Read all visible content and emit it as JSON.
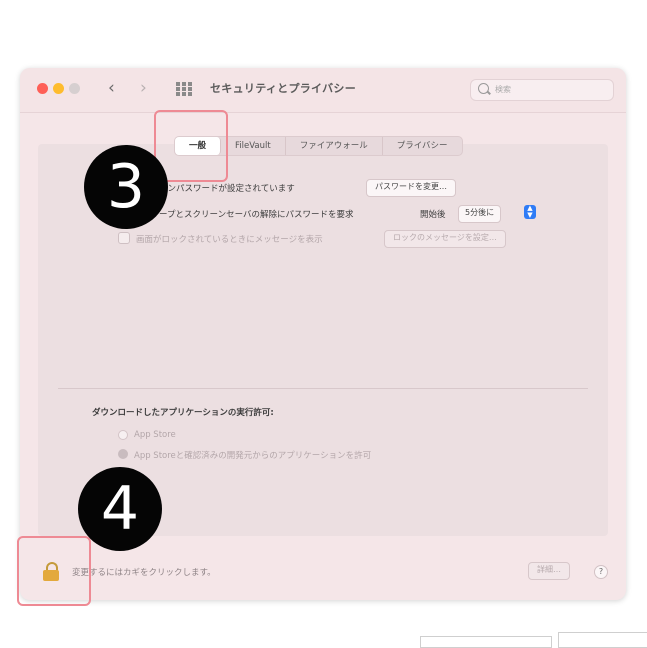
{
  "window": {
    "title": "セキュリティとプライバシー",
    "search_placeholder": "検索",
    "nav_back": "‹",
    "nav_forward": "›"
  },
  "tabs": [
    {
      "label": "一般",
      "active": true
    },
    {
      "label": "FileVault",
      "active": false
    },
    {
      "label": "ファイアウォール",
      "active": false
    },
    {
      "label": "プライバシー",
      "active": false
    }
  ],
  "general": {
    "login_password_label": "ログインパスワードが設定されています",
    "change_password_button": "パスワードを変更…",
    "require_password_label": "スリープとスクリーンセーバの解除にパスワードを要求",
    "require_timing_label": "開始後",
    "require_timing_value": "5分後に",
    "lock_message_label": "画面がロックされているときにメッセージを表示",
    "lock_message_button": "ロックのメッセージを設定…"
  },
  "downloads": {
    "heading": "ダウンロードしたアプリケーションの実行許可:",
    "option_app_store": "App Store",
    "option_identified": "App Storeと確認済みの開発元からのアプリケーションを許可"
  },
  "footer": {
    "lock_text": "変更するにはカギをクリックします。",
    "advanced_button": "詳細…",
    "help": "?"
  },
  "annotations": {
    "step_3": "3",
    "step_4": "4"
  },
  "colors": {
    "window_bg": "#f5e6e8",
    "accent_blue": "#2f7cf6",
    "highlight_red": "#ee8a94",
    "badge_black": "#050505"
  }
}
